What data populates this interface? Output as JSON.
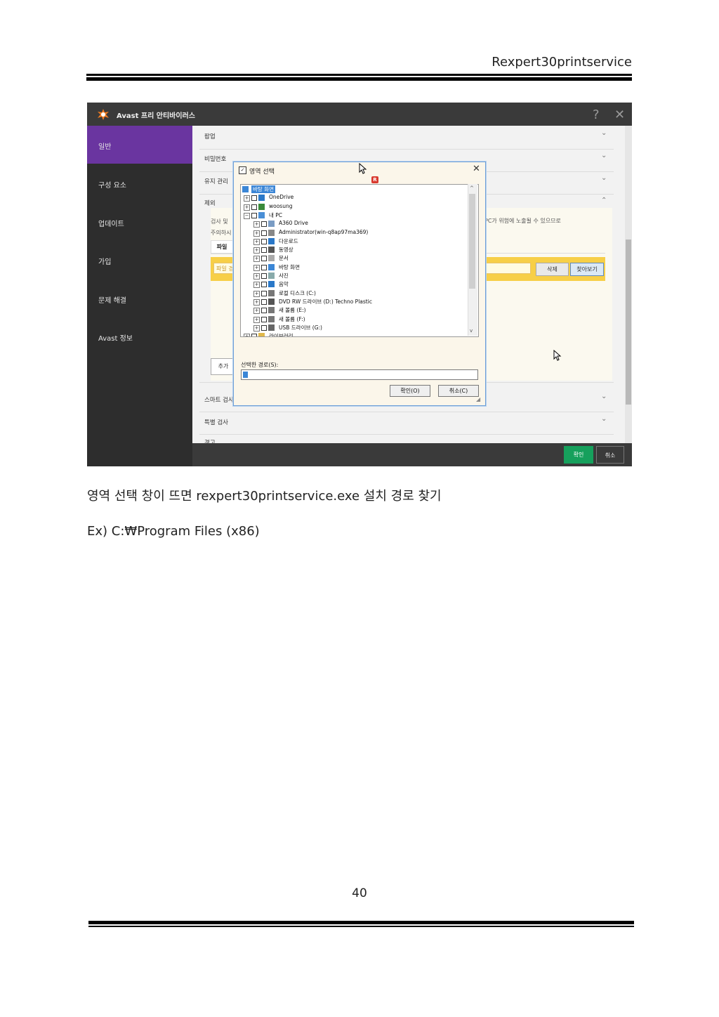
{
  "doc_header": "Rexpert30printservice",
  "screenshot": {
    "app_title": "Avast 프리 안티바이러스",
    "help_icon": "?",
    "close_icon": "✕",
    "sidebar": [
      {
        "label": "일반"
      },
      {
        "label": "구성 요소"
      },
      {
        "label": "업데이트"
      },
      {
        "label": "가입"
      },
      {
        "label": "문제 해결"
      },
      {
        "label": "Avast 정보"
      }
    ],
    "sections": {
      "popup": "팝업",
      "password": "비밀번호",
      "maintenance": "유지 관리",
      "exclusion": "제외",
      "smart_scan": "스마트 검사",
      "special_scan": "특별 검사",
      "warning": "경고"
    },
    "exclusion_text_left_1": "검사 및",
    "exclusion_text_left_2": "주의하시",
    "exclusion_text_right": "PC가 위험에 노출될 수 있으므로",
    "tab_file": "파일",
    "field_placeholder": "파일 경",
    "delete_button": "삭제",
    "browse_button": "찾아보기",
    "add_button": "추가",
    "ok_button": "확인",
    "cancel_button": "취소",
    "dialog": {
      "title": "영역 선택",
      "tree": [
        {
          "label": "바탕 화면",
          "level": 0,
          "selected": true,
          "icon": "desktop"
        },
        {
          "label": "OneDrive",
          "level": 1,
          "icon": "cloud"
        },
        {
          "label": "woosung",
          "level": 1,
          "icon": "user"
        },
        {
          "label": "내 PC",
          "level": 1,
          "icon": "pc",
          "expanded": true
        },
        {
          "label": "A360 Drive",
          "level": 2,
          "icon": "drive"
        },
        {
          "label": "Administrator(win-q8ap97ma369)",
          "level": 2,
          "icon": "network"
        },
        {
          "label": "다운로드",
          "level": 2,
          "icon": "download"
        },
        {
          "label": "동영상",
          "level": 2,
          "icon": "video"
        },
        {
          "label": "문서",
          "level": 2,
          "icon": "document"
        },
        {
          "label": "바탕 화면",
          "level": 2,
          "icon": "desktop"
        },
        {
          "label": "사진",
          "level": 2,
          "icon": "picture"
        },
        {
          "label": "음악",
          "level": 2,
          "icon": "music"
        },
        {
          "label": "로컬 디스크 (C:)",
          "level": 2,
          "icon": "disk"
        },
        {
          "label": "DVD RW 드라이브 (D:) Techno Plastic",
          "level": 2,
          "icon": "dvd"
        },
        {
          "label": "새 볼륨 (E:)",
          "level": 2,
          "icon": "disk"
        },
        {
          "label": "새 볼륨 (F:)",
          "level": 2,
          "icon": "disk"
        },
        {
          "label": "USB 드라이브 (G:)",
          "level": 2,
          "icon": "usb"
        },
        {
          "label": "라이브러리",
          "level": 1,
          "icon": "library"
        }
      ],
      "path_label": "선택한 경로(S):",
      "path_value": "",
      "ok_button": "확인(O)",
      "cancel_button": "취소(C)",
      "badge": "R"
    }
  },
  "caption_1": "영역 선택 창이 뜨면 rexpert30printservice.exe 설치 경로 찾기",
  "caption_2": "Ex) C:₩Program Files (x86)",
  "page_number": "40"
}
